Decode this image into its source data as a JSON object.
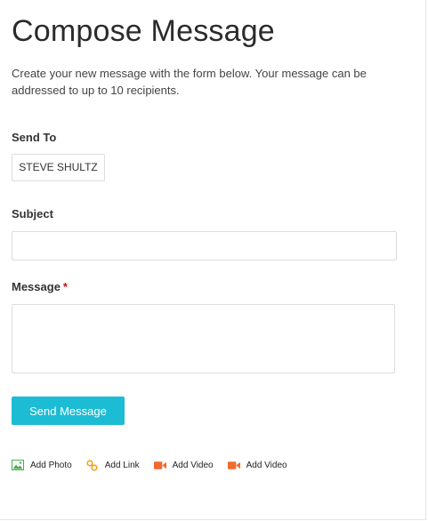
{
  "page": {
    "title": "Compose Message",
    "intro": "Create your new message with the form below. Your message can be addressed to up to 10 recipients."
  },
  "form": {
    "send_to_label": "Send To",
    "recipients": [
      "STEVE SHULTZ"
    ],
    "subject_label": "Subject",
    "subject_value": "",
    "message_label": "Message",
    "message_required_marker": "*",
    "message_value": "",
    "submit_label": "Send Message"
  },
  "attachments": [
    {
      "label": "Add Photo",
      "icon": "photo-icon",
      "color": "#4caf50"
    },
    {
      "label": "Add Link",
      "icon": "link-icon",
      "color": "#f0a020"
    },
    {
      "label": "Add Video",
      "icon": "video-icon",
      "color": "#f26a2e"
    },
    {
      "label": "Add Video",
      "icon": "video-icon",
      "color": "#f26a2e"
    }
  ],
  "colors": {
    "accent": "#1cbcd4",
    "required": "#cc1111"
  }
}
